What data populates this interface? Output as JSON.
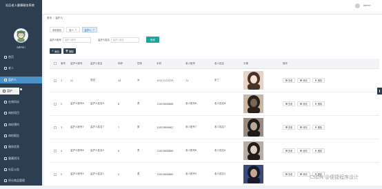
{
  "sidebar": {
    "app_title": "社区老人健康服务系统",
    "user": "admin",
    "menu": [
      {
        "label": "首页",
        "icon": "home-icon",
        "sub": false,
        "active": false
      },
      {
        "label": "老人",
        "icon": "user-icon",
        "sub": false,
        "active": false
      },
      {
        "label": "监护人",
        "icon": "user-icon",
        "sub": false,
        "active": true
      },
      {
        "label": "监护",
        "icon": "list-icon",
        "sub": true,
        "active": true
      },
      {
        "label": "在线问诊",
        "icon": "chat-icon",
        "sub": false,
        "active": false
      },
      {
        "label": "体检项目",
        "icon": "clipboard-icon",
        "sub": false,
        "active": false
      },
      {
        "label": "体检预约",
        "icon": "calendar-icon",
        "sub": false,
        "active": false
      },
      {
        "label": "体检报告",
        "icon": "report-icon",
        "sub": false,
        "active": false
      },
      {
        "label": "服务信息",
        "icon": "info-icon",
        "sub": false,
        "active": false
      },
      {
        "label": "健康资讯",
        "icon": "news-icon",
        "sub": false,
        "active": false
      },
      {
        "label": "社区公告",
        "icon": "notice-icon",
        "sub": false,
        "active": false
      },
      {
        "label": "积分商品管理",
        "icon": "gift-icon",
        "sub": false,
        "active": false
      }
    ]
  },
  "topbar": {
    "user": "admin"
  },
  "breadcrumb": {
    "home": "首页",
    "current": "监护人"
  },
  "tabs": [
    {
      "label": "系统首页",
      "active": false,
      "closable": false
    },
    {
      "label": "老人",
      "active": false,
      "closable": true
    },
    {
      "label": "监护人",
      "active": true,
      "closable": true
    }
  ],
  "search": {
    "field1_label": "监护人账号",
    "field1_placeholder": "监护人账号",
    "field2_label": "监护人姓名",
    "field2_placeholder": "监护人姓名",
    "button": "查询"
  },
  "actions": {
    "add": "添加",
    "delete": "删除"
  },
  "table": {
    "headers": [
      "",
      "索号",
      "监护人账号",
      "监护人姓名",
      "年龄",
      "性别",
      "手机",
      "老人账号",
      "老人姓名",
      "头像",
      "操作"
    ],
    "rows": [
      {
        "idx": "1",
        "account": "22",
        "name": "张四",
        "age": "44",
        "sex": "女",
        "phone": "15111122233",
        "elder_account": "11",
        "elder_name": "张三",
        "photo_colors": [
          "#e8d3c4",
          "#4a3228",
          "#f2e2d5"
        ]
      },
      {
        "idx": "2",
        "account": "监护人账号8",
        "name": "监护人姓名8",
        "age": "8",
        "sex": "男",
        "phone": "13823888888",
        "elder_account": "老人账号8",
        "elder_name": "老人姓名8",
        "photo_colors": [
          "#c9b7a3",
          "#2b211c",
          "#7a6452"
        ]
      },
      {
        "idx": "3",
        "account": "监护人账号7",
        "name": "监护人姓名7",
        "age": "7",
        "sex": "男",
        "phone": "13823888887",
        "elder_account": "老人账号7",
        "elder_name": "老人姓名7",
        "photo_colors": [
          "#9a8a82",
          "#1e1a1a",
          "#b8a596"
        ]
      },
      {
        "idx": "4",
        "account": "监护人账号6",
        "name": "监护人姓名6",
        "age": "6",
        "sex": "男",
        "phone": "13823888886",
        "elder_account": "老人账号6",
        "elder_name": "老人姓名6",
        "photo_colors": [
          "#b9aca3",
          "#231c1a",
          "#e0d0c2"
        ]
      },
      {
        "idx": "5",
        "account": "监护人账号5",
        "name": "监护人姓名5",
        "age": "5",
        "sex": "男",
        "phone": "13823888885",
        "elder_account": "老人账号5",
        "elder_name": "老人姓名5",
        "photo_colors": [
          "#3b4a7a",
          "#161a2e",
          "#c9a78e"
        ]
      }
    ],
    "ops": {
      "view": "查看",
      "edit": "修改",
      "delete": "删除"
    }
  },
  "watermark": "CSDN @便捷程序设计"
}
